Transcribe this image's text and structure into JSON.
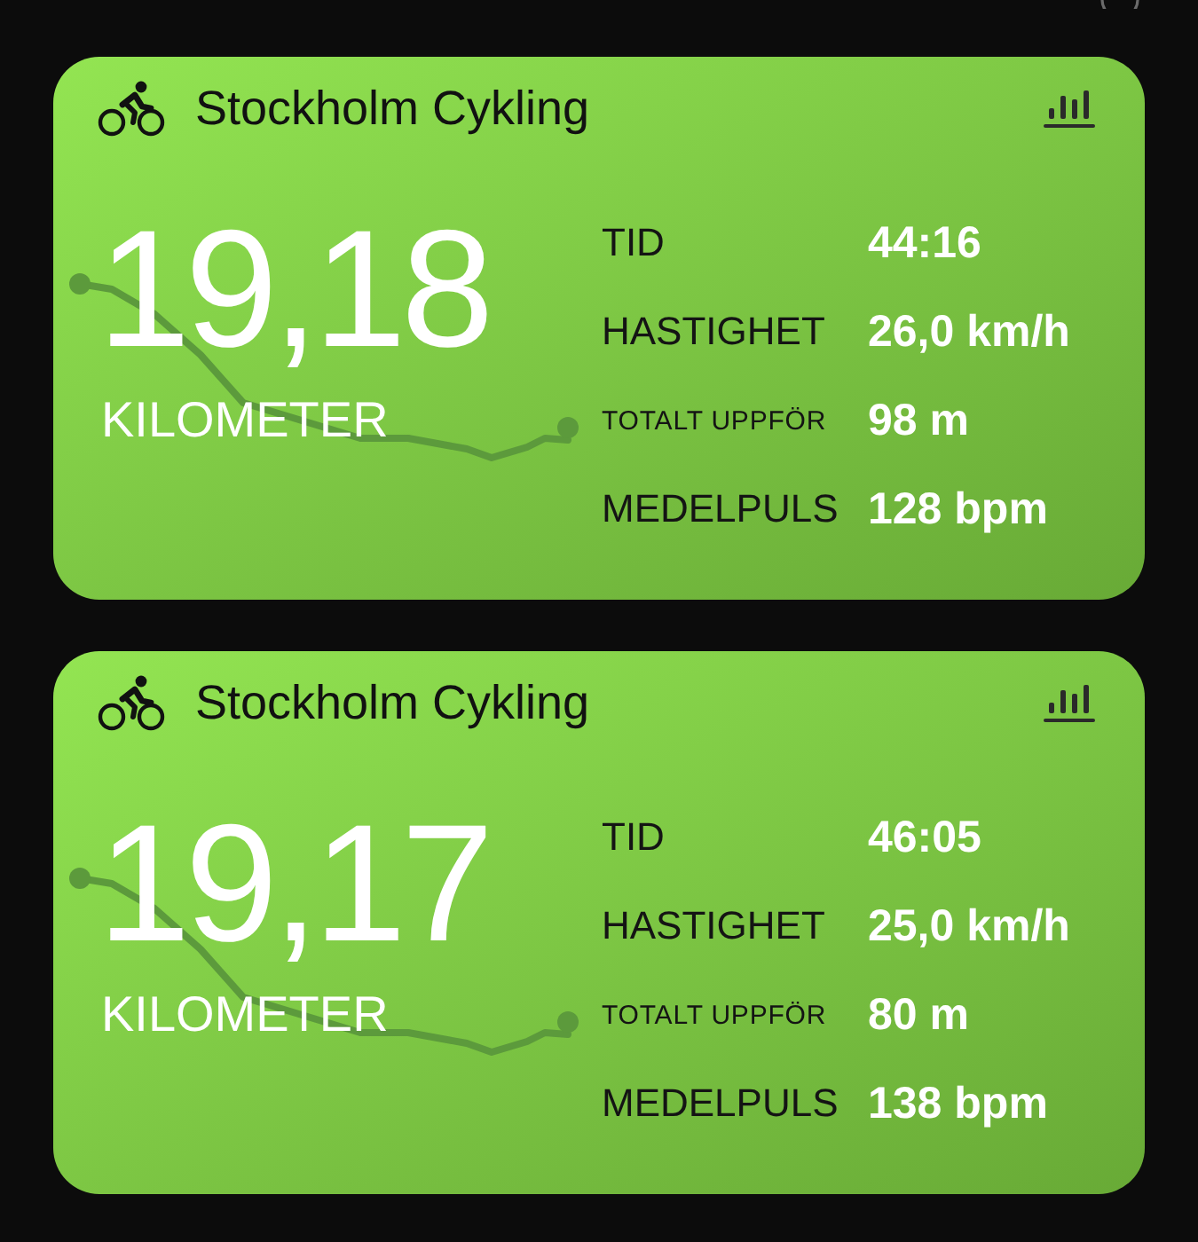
{
  "cards": [
    {
      "title": "Stockholm Cykling",
      "distance": "19,18",
      "unit": "KILOMETER",
      "stats": [
        {
          "kind": "regular",
          "label": "TID",
          "value": "44:16"
        },
        {
          "kind": "regular",
          "label": "HASTIGHET",
          "value": "26,0 km/h"
        },
        {
          "kind": "compact",
          "label": "TOTALT UPPFÖR",
          "value": "98 m"
        },
        {
          "kind": "regular",
          "label": "MEDELPULS",
          "value": "128 bpm"
        }
      ]
    },
    {
      "title": "Stockholm Cykling",
      "distance": "19,17",
      "unit": "KILOMETER",
      "stats": [
        {
          "kind": "regular",
          "label": "TID",
          "value": "46:05"
        },
        {
          "kind": "regular",
          "label": "HASTIGHET",
          "value": "25,0 km/h"
        },
        {
          "kind": "compact",
          "label": "TOTALT UPPFÖR",
          "value": "80 m"
        },
        {
          "kind": "regular",
          "label": "MEDELPULS",
          "value": "138 bpm"
        }
      ]
    }
  ]
}
